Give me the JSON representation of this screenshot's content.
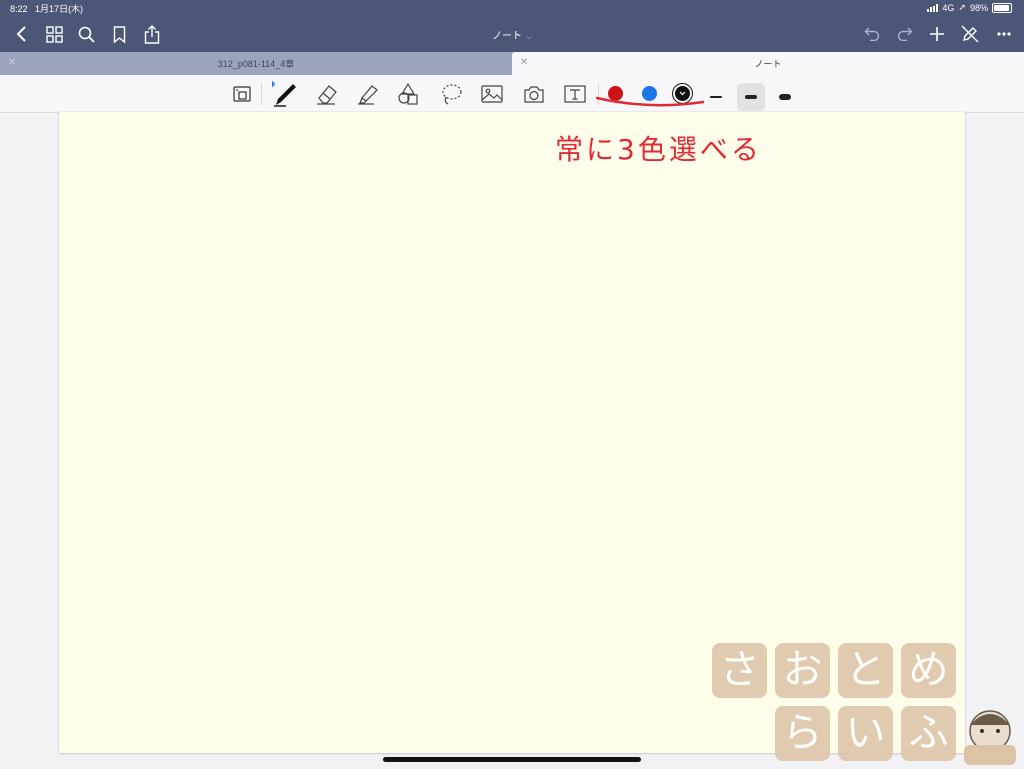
{
  "status_bar": {
    "time": "8:22",
    "date": "1月17日(木)",
    "network": "4G",
    "battery": "98%"
  },
  "navbar": {
    "title": "ノート",
    "icons": [
      "back-chevron-icon",
      "grid-icon",
      "search-icon",
      "bookmark-icon",
      "share-icon",
      "undo-icon",
      "redo-icon",
      "plus-icon",
      "no-edit-icon",
      "more-icon"
    ]
  },
  "tabs": [
    {
      "label": "312_p081-114_4章",
      "active": false
    },
    {
      "label": "ノート",
      "active": true
    }
  ],
  "toolbar": {
    "tools": [
      "zoom-window-icon",
      "pen-icon",
      "eraser-icon",
      "highlighter-icon",
      "shapes-icon",
      "lasso-icon",
      "image-icon",
      "camera-icon",
      "text-icon"
    ],
    "colors": [
      "#cc1218",
      "#1b74ea",
      "#111111"
    ],
    "selected_color_index": 2,
    "thicknesses": [
      "thin",
      "medium",
      "thick"
    ],
    "selected_thickness_index": 1
  },
  "annotation": {
    "text": "常に3色選べる",
    "color": "#e02b35"
  },
  "watermark": {
    "row1": [
      "さ",
      "お",
      "と",
      "め"
    ],
    "row2": [
      "ら",
      "い",
      "ふ"
    ]
  }
}
